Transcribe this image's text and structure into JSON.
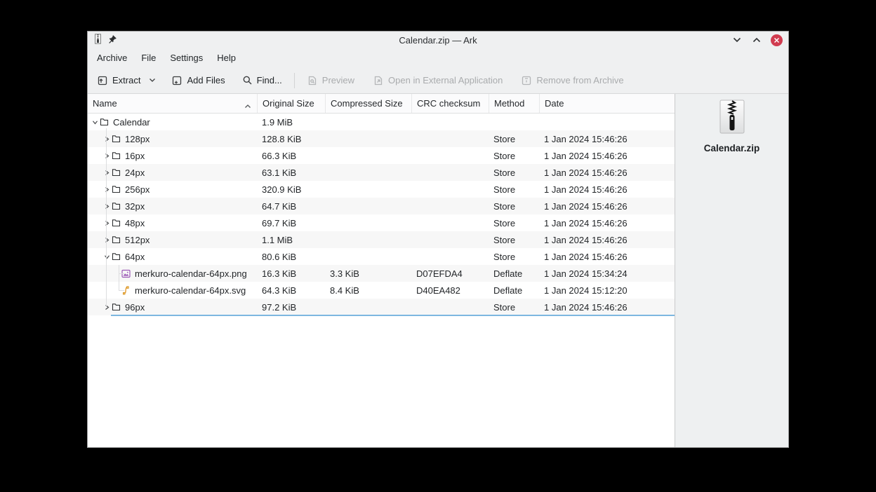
{
  "window": {
    "title": "Calendar.zip — Ark",
    "controls": {
      "minimize": "minimize",
      "maximize": "maximize",
      "close": "close"
    }
  },
  "menu": {
    "items": [
      "Archive",
      "File",
      "Settings",
      "Help"
    ]
  },
  "toolbar": {
    "extract": "Extract",
    "add_files": "Add Files",
    "find": "Find...",
    "preview": "Preview",
    "open_external": "Open in External Application",
    "remove": "Remove from Archive"
  },
  "table": {
    "columns": [
      "Name",
      "Original Size",
      "Compressed Size",
      "CRC checksum",
      "Method",
      "Date"
    ],
    "sort": {
      "column": "Name",
      "direction": "ascending"
    },
    "rows": [
      {
        "name": "Calendar",
        "depth": 0,
        "kind": "folder",
        "state": "expanded",
        "original_size": "1.9 MiB",
        "compressed_size": "",
        "crc": "",
        "method": "",
        "date": ""
      },
      {
        "name": "128px",
        "depth": 1,
        "kind": "folder",
        "state": "collapsed",
        "original_size": "128.8 KiB",
        "compressed_size": "",
        "crc": "",
        "method": "Store",
        "date": "1 Jan 2024 15:46:26"
      },
      {
        "name": "16px",
        "depth": 1,
        "kind": "folder",
        "state": "collapsed",
        "original_size": "66.3 KiB",
        "compressed_size": "",
        "crc": "",
        "method": "Store",
        "date": "1 Jan 2024 15:46:26"
      },
      {
        "name": "24px",
        "depth": 1,
        "kind": "folder",
        "state": "collapsed",
        "original_size": "63.1 KiB",
        "compressed_size": "",
        "crc": "",
        "method": "Store",
        "date": "1 Jan 2024 15:46:26"
      },
      {
        "name": "256px",
        "depth": 1,
        "kind": "folder",
        "state": "collapsed",
        "original_size": "320.9 KiB",
        "compressed_size": "",
        "crc": "",
        "method": "Store",
        "date": "1 Jan 2024 15:46:26"
      },
      {
        "name": "32px",
        "depth": 1,
        "kind": "folder",
        "state": "collapsed",
        "original_size": "64.7 KiB",
        "compressed_size": "",
        "crc": "",
        "method": "Store",
        "date": "1 Jan 2024 15:46:26"
      },
      {
        "name": "48px",
        "depth": 1,
        "kind": "folder",
        "state": "collapsed",
        "original_size": "69.7 KiB",
        "compressed_size": "",
        "crc": "",
        "method": "Store",
        "date": "1 Jan 2024 15:46:26"
      },
      {
        "name": "512px",
        "depth": 1,
        "kind": "folder",
        "state": "collapsed",
        "original_size": "1.1 MiB",
        "compressed_size": "",
        "crc": "",
        "method": "Store",
        "date": "1 Jan 2024 15:46:26"
      },
      {
        "name": "64px",
        "depth": 1,
        "kind": "folder",
        "state": "expanded",
        "original_size": "80.6 KiB",
        "compressed_size": "",
        "crc": "",
        "method": "Store",
        "date": "1 Jan 2024 15:46:26"
      },
      {
        "name": "merkuro-calendar-64px.png",
        "depth": 2,
        "kind": "image-png",
        "state": "leaf",
        "original_size": "16.3 KiB",
        "compressed_size": "3.3 KiB",
        "crc": "D07EFDA4",
        "method": "Deflate",
        "date": "1 Jan 2024 15:34:24"
      },
      {
        "name": "merkuro-calendar-64px.svg",
        "depth": 2,
        "kind": "image-svg",
        "state": "leaf",
        "original_size": "64.3 KiB",
        "compressed_size": "8.4 KiB",
        "crc": "D40EA482",
        "method": "Deflate",
        "date": "1 Jan 2024 15:12:20"
      },
      {
        "name": "96px",
        "depth": 1,
        "kind": "folder",
        "state": "collapsed",
        "original_size": "97.2 KiB",
        "compressed_size": "",
        "crc": "",
        "method": "Store",
        "date": "1 Jan 2024 15:46:26",
        "underlined": true
      }
    ]
  },
  "side_panel": {
    "file_name": "Calendar.zip",
    "file_icon": "zip-archive-icon"
  },
  "colors": {
    "window_bg": "#eff0f1",
    "table_bg": "#ffffff",
    "row_alt": "#f7f7f7",
    "selection_line": "#7db7e0",
    "close_button": "#d13c50",
    "disabled_text": "#a9abad",
    "png_icon": "#9b59b6",
    "svg_icon": "#e8a33d"
  }
}
